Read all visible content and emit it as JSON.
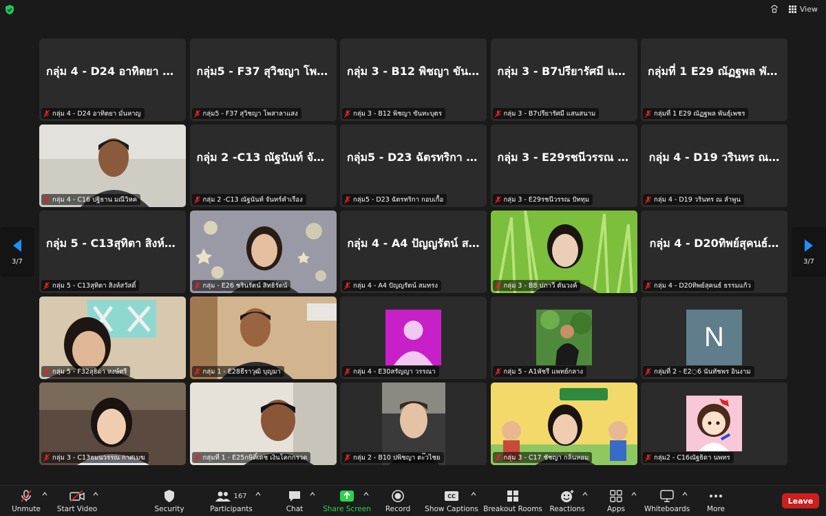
{
  "top_bar": {
    "view_label": "View"
  },
  "navigation": {
    "page_left": "3/7",
    "page_right": "3/7"
  },
  "tiles": [
    {
      "name": "กลุ่ม 4 - D24 อาทิตยา มั่…",
      "label": "กลุ่ม 4 - D24 อาทิตยา มั่นหาญ"
    },
    {
      "name": "กลุ่ม5 - F37 สุวิชญา โพส…",
      "label": "กลุ่ม5 - F37 สุวิชญา โพสาลาแสง"
    },
    {
      "name": "กลุ่ม 3 - B12 พิชญา ขันท…",
      "label": "กลุ่ม 3 - B12 พิชญา ขันทะบุตร"
    },
    {
      "name": "กลุ่ม 3 - B7ปรียารัศมี แส…",
      "label": "กลุ่ม 3 - B7ปรียารัศมี แสนสนาม"
    },
    {
      "name": "กลุ่มที่ 1 E29 ณัฏฐพล พัน…",
      "label": "กลุ่มที่ 1 E29 ณัฏฐพล พันธุ์เพชร"
    },
    {
      "name": "",
      "label": "กลุ่ม 4 - C16 ปฐิธาน มณีวิหค"
    },
    {
      "name": "กลุ่ม 2 -C13 ณัฐนันท์ จัน…",
      "label": "กลุ่ม 2 -C13 ณัฐนันท์ จันทร์คำเรือง"
    },
    {
      "name": "กลุ่ม5 - D23 ฉัตรทริกา ก…",
      "label": "กลุ่ม5 - D23 ฉัตรทริกา กอบเกื้อ"
    },
    {
      "name": "กลุ่ม 3 - E29รชนีวรรณ ปั…",
      "label": "กลุ่ม 3 - E29รชนีวรรณ ปัททุม"
    },
    {
      "name": "กลุ่ม 4 - D19 วรินทร ณ…",
      "label": "กลุ่ม 4 - D19 วรินทร ณ ลำพูน"
    },
    {
      "name": "กลุ่ม 5 - C13สุทิตา สิงห์ส…",
      "label": "กลุ่ม 5 - C13สุทิตา สิงห์สวัสดิ์"
    },
    {
      "name": "",
      "label": "กลุ่ม  - E26 ชรินรัตน์  สิทธิรัตน์"
    },
    {
      "name": "กลุ่ม 4 - A4 ปัญญรัตน์ ส…",
      "label": "กลุ่ม 4 - A4 ปัญญรัตน์ สมทรง"
    },
    {
      "name": "",
      "label": "กลุ่ม 3 - B8 ปภาวี ตันวงค์"
    },
    {
      "name": "กลุ่ม 4 - D20ทิพย์สุคนธ์…",
      "label": "กลุ่ม 4 - D20ทิพย์สุคนธ์ ธรรมแก้ว"
    },
    {
      "name": "",
      "label": "กลุ่ม 5 - F32สุธิดา หงษ์ศรี"
    },
    {
      "name": "",
      "label": "กลุ่ม 1 - E28ธีราวุฒิ บุญมา"
    },
    {
      "name": "",
      "label": "กลุ่ม 4 - E30สรัญญา วรรณา"
    },
    {
      "name": "",
      "label": "กลุ่ม 5 - A1พัชรี แพทย์กลาง"
    },
    {
      "name": "",
      "label": "กลุ่มที่ 2 - E2◌6 นันทัชพร อินงาม"
    },
    {
      "name": "",
      "label": "กลุ่ม 3 - C13ธมนวรรณ กาศเมฆ"
    },
    {
      "name": "",
      "label": "กลุ่มที่ 1 - E25กษิดิ์เดช เงินโคกกรวด"
    },
    {
      "name": "",
      "label": "กลุ่ม 2 - B10 ปพิชญา ตะ๊วไชย"
    },
    {
      "name": "",
      "label": "กลุ่ม 3 - C17 ชัชญา กลิ่นหอม"
    },
    {
      "name": "",
      "label": "กลุ่ม2 - C16ณัฐธิดา นพทร"
    }
  ],
  "avatars": {
    "n_letter": "N"
  },
  "toolbar": {
    "unmute": "Unmute",
    "start_video": "Start Video",
    "security": "Security",
    "participants": "Participants",
    "participants_count": "167",
    "chat": "Chat",
    "share_screen": "Share Screen",
    "record": "Record",
    "show_captions": "Show Captions",
    "captions_badge": "CC",
    "breakout_rooms": "Breakout Rooms",
    "reactions": "Reactions",
    "apps": "Apps",
    "whiteboards": "Whiteboards",
    "more": "More",
    "leave": "Leave"
  },
  "colors": {
    "leave": "#cc1f1f",
    "share": "#2bd34a",
    "tile": "#2b2b2b",
    "avatar_magenta": "#c820c8",
    "avatar_n": "#607d8b"
  }
}
